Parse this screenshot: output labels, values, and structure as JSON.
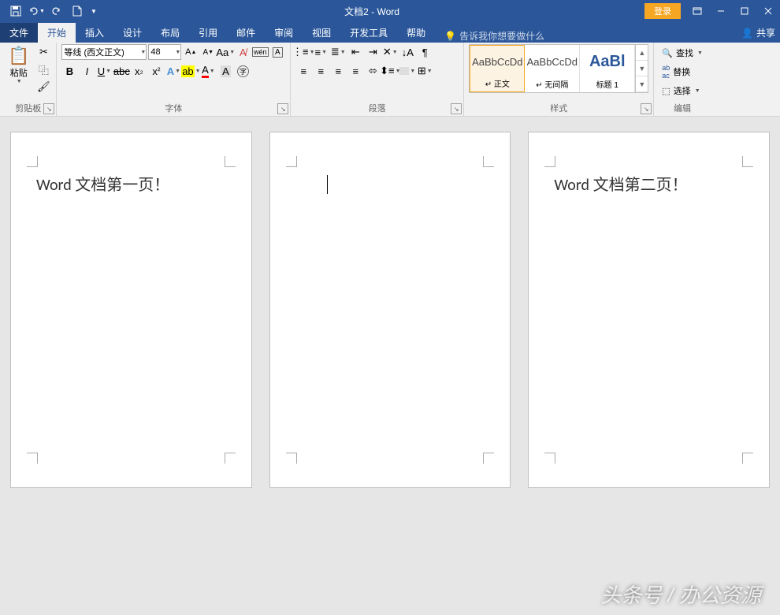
{
  "title": {
    "doc": "文档2",
    "app": "Word",
    "sep": " - "
  },
  "qat": {
    "save": "保存",
    "undo": "撤消",
    "redo": "重做",
    "new": "新建"
  },
  "login_label": "登录",
  "tabs": {
    "file": "文件",
    "home": "开始",
    "insert": "插入",
    "design": "设计",
    "layout": "布局",
    "references": "引用",
    "mailings": "邮件",
    "review": "审阅",
    "view": "视图",
    "developer": "开发工具",
    "help": "帮助"
  },
  "tellme": "告诉我你想要做什么",
  "share": "共享",
  "clipboard": {
    "paste": "粘贴",
    "label": "剪贴板"
  },
  "font": {
    "name": "等线 (西文正文)",
    "size": "48",
    "label": "字体",
    "bold": "B",
    "italic": "I",
    "underline": "U"
  },
  "paragraph": {
    "label": "段落"
  },
  "styles": {
    "label": "样式",
    "items": [
      {
        "preview": "AaBbCcDd",
        "name": "↵ 正文"
      },
      {
        "preview": "AaBbCcDd",
        "name": "↵ 无间隔"
      },
      {
        "preview": "AaBl",
        "name": "标题 1"
      }
    ]
  },
  "editing": {
    "find": "查找",
    "replace": "替换",
    "select": "选择",
    "label": "编辑"
  },
  "pages": {
    "p1": "Word 文档第一页！",
    "p2": "",
    "p3": "Word 文档第二页！"
  },
  "watermark": "头条号 / 办公资源"
}
